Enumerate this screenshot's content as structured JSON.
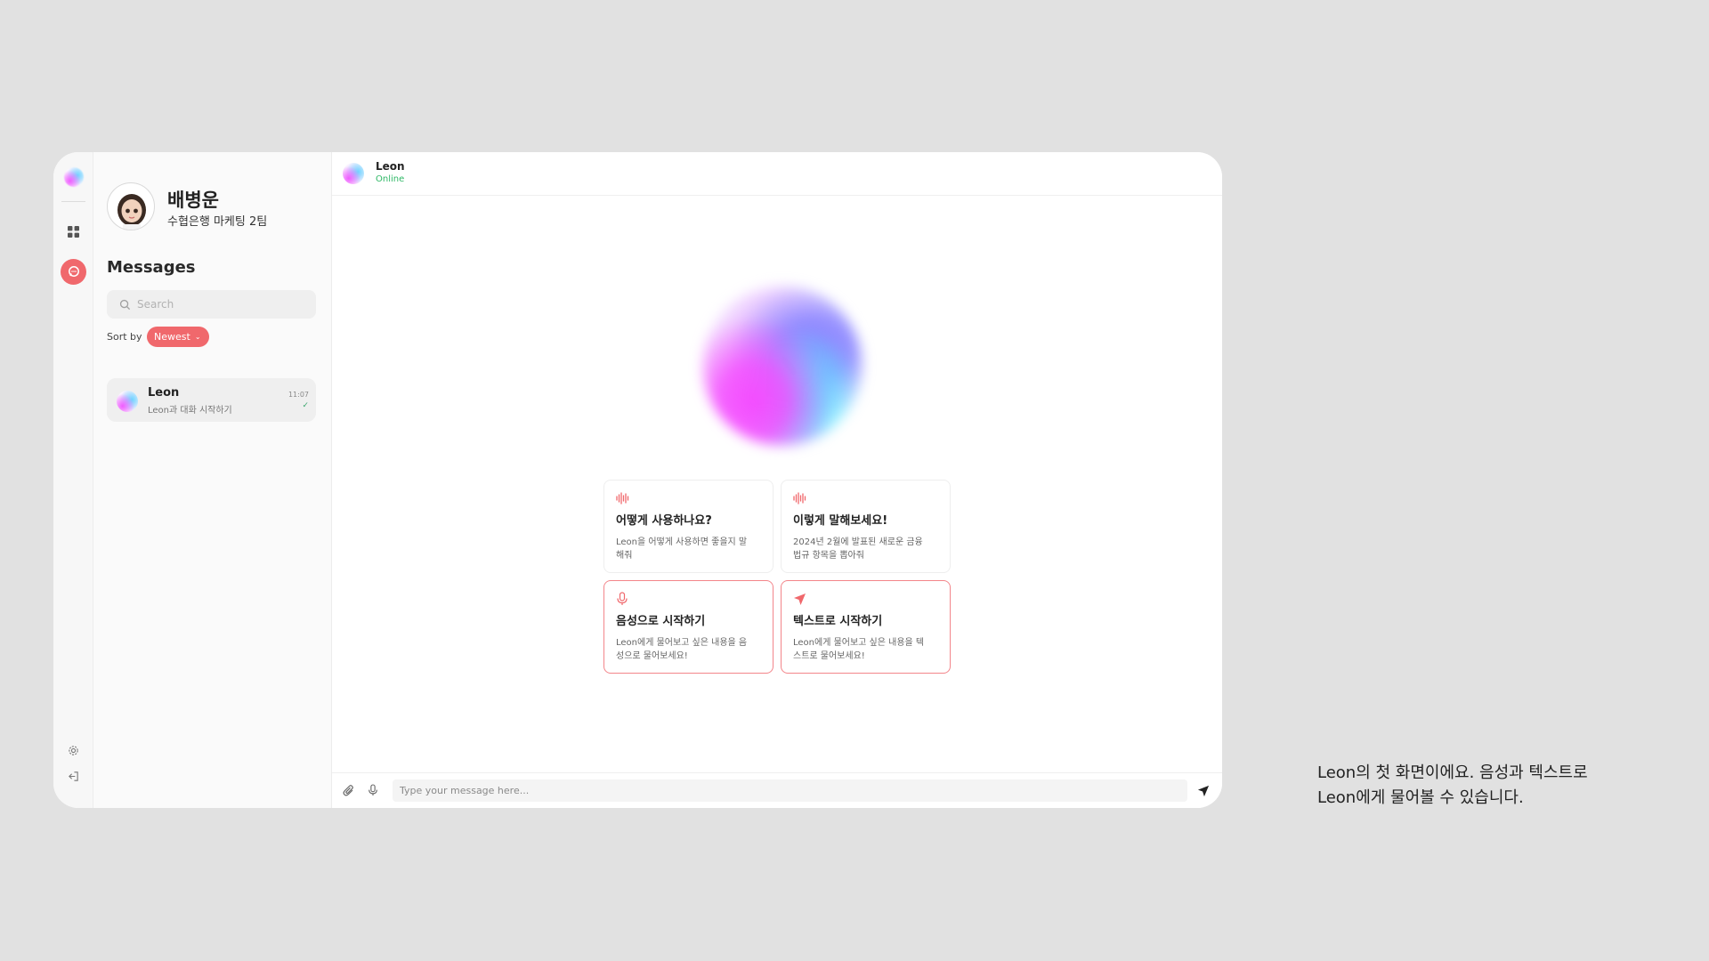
{
  "profile": {
    "name": "배병운",
    "team": "수협은행 마케팅 2팀"
  },
  "sidebar": {
    "title": "Messages",
    "search_placeholder": "Search",
    "sort_label": "Sort by",
    "sort_value": "Newest"
  },
  "conversations": [
    {
      "name": "Leon",
      "preview": "Leon과 대화 시작하기",
      "time": "11:07"
    }
  ],
  "chat": {
    "contact_name": "Leon",
    "status": "Online"
  },
  "cards": [
    {
      "title": "어떻게 사용하나요?",
      "desc": "Leon을 어떻게 사용하면 좋을지 말해줘",
      "icon": "waveform-icon"
    },
    {
      "title": "이렇게 말해보세요!",
      "desc": "2024년 2월에 발표된 새로운 금융 법규 항목을 뽑아줘",
      "icon": "waveform-icon"
    },
    {
      "title": "음성으로 시작하기",
      "desc": "Leon에게 물어보고 싶은 내용을 음성으로 물어보세요!",
      "icon": "mic-icon"
    },
    {
      "title": "텍스트로 시작하기",
      "desc": "Leon에게 물어보고 싶은 내용을 텍스트로 물어보세요!",
      "icon": "send-icon"
    }
  ],
  "composer": {
    "placeholder": "Type your message here..."
  },
  "caption": {
    "line1": "Leon의 첫 화면이에요. 음성과 텍스트로",
    "line2": "Leon에게 물어볼 수 있습니다."
  },
  "colors": {
    "accent": "#f0686c",
    "online": "#2fb866",
    "background": "#e1e1e1"
  }
}
